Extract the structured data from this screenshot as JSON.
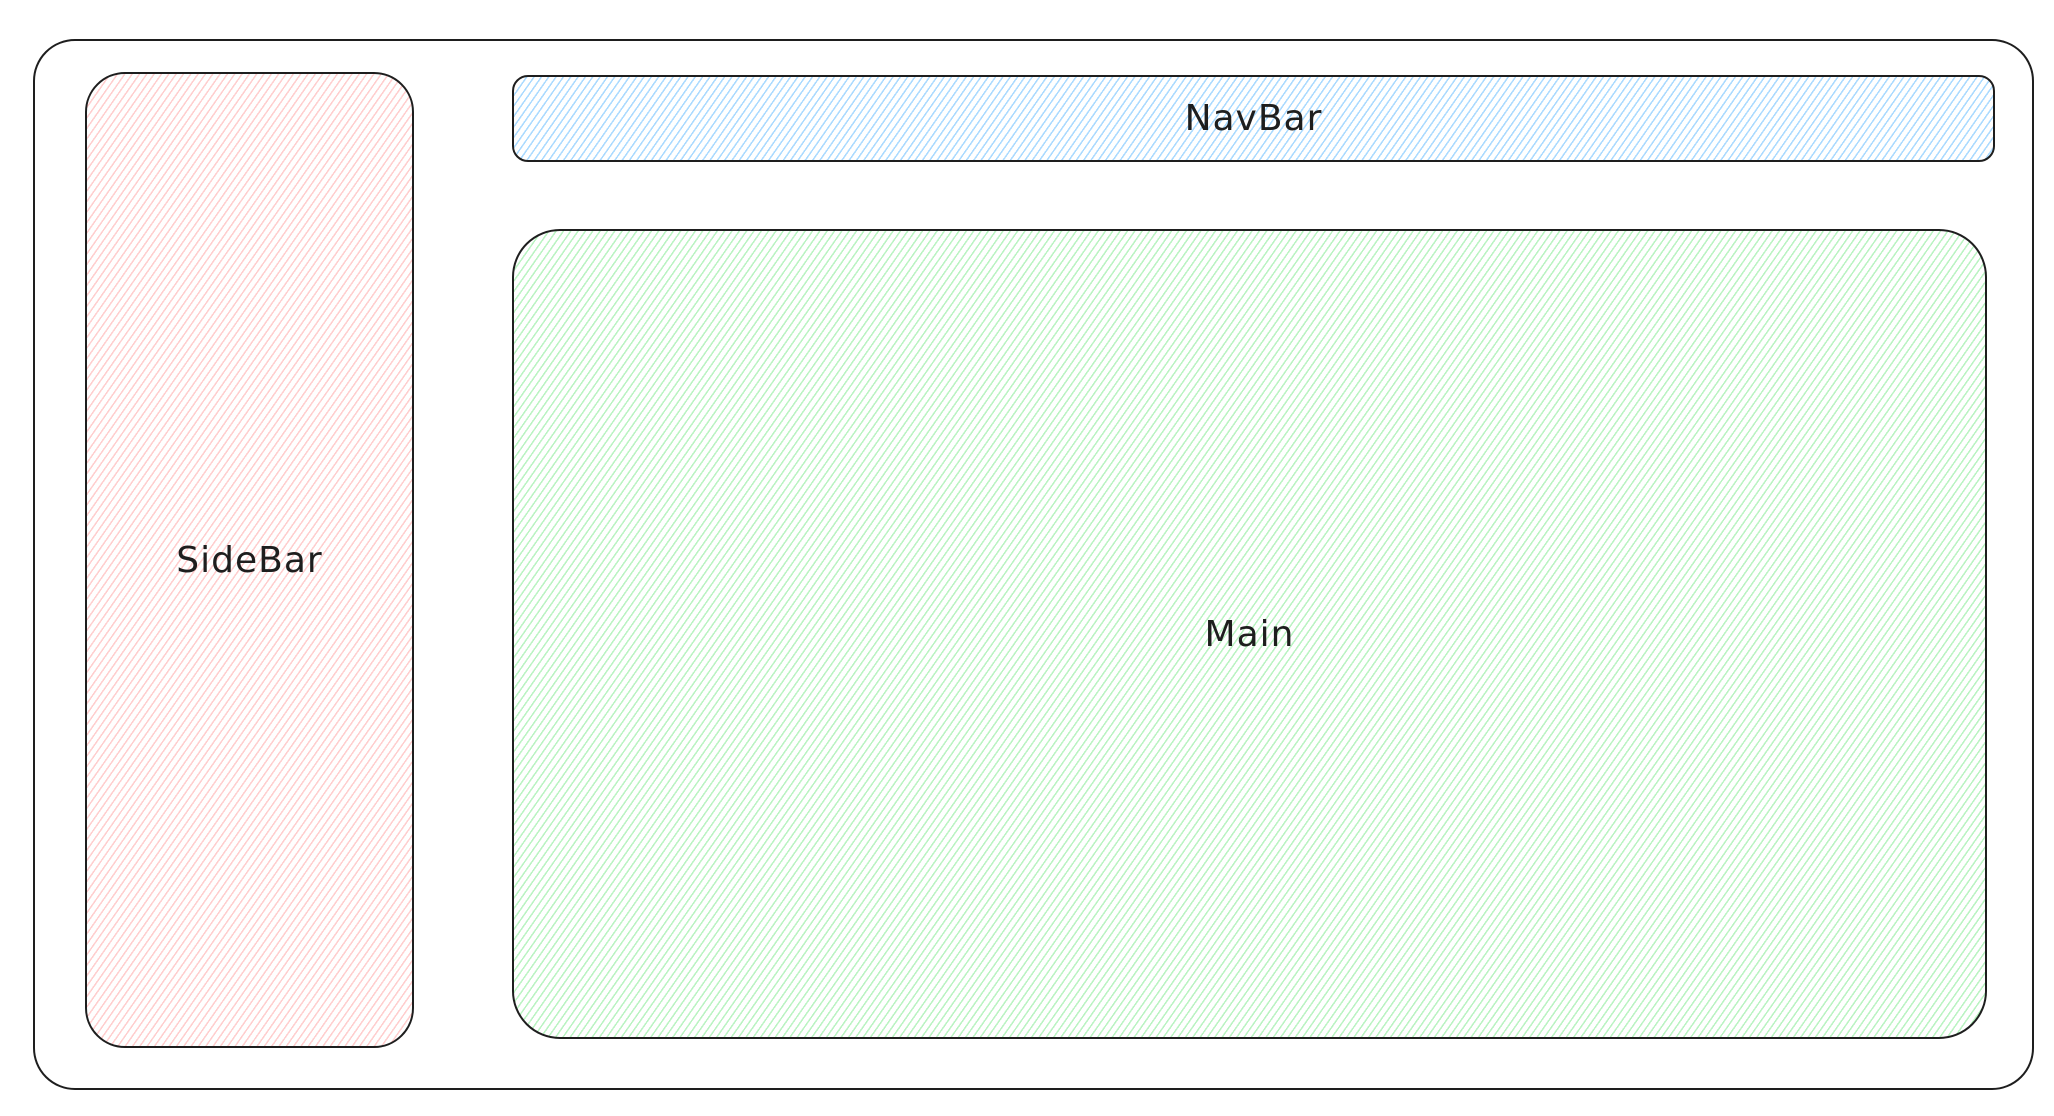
{
  "diagram": {
    "colors": {
      "stroke": "#1e1e1e",
      "sidebar_fill": "#ffc9c9",
      "navbar_fill": "#a5d8ff",
      "main_fill": "#b2f2bb"
    },
    "sidebar": {
      "label": "SideBar"
    },
    "navbar": {
      "label": "NavBar"
    },
    "main": {
      "label": "Main"
    }
  }
}
